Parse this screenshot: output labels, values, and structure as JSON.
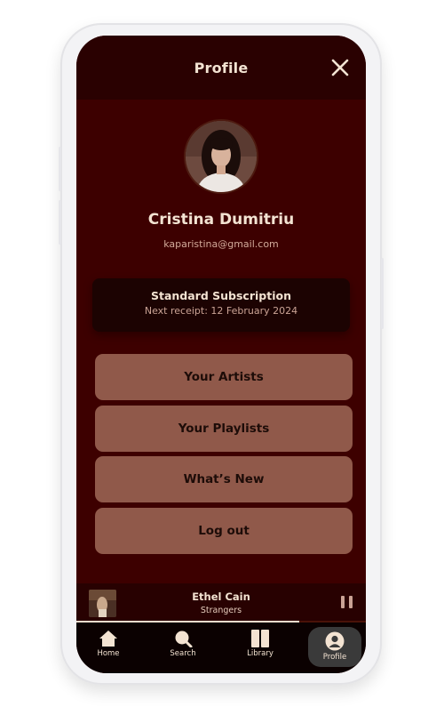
{
  "header": {
    "title": "Profile"
  },
  "profile": {
    "name": "Cristina Dumitriu",
    "email": "kaparistina@gmail.com"
  },
  "subscription": {
    "plan": "Standard Subscription",
    "next_receipt": "Next receipt: 12 February 2024"
  },
  "menu": [
    {
      "label": "Your Artists"
    },
    {
      "label": "Your Playlists"
    },
    {
      "label": "What’s New"
    },
    {
      "label": "Log out"
    }
  ],
  "now_playing": {
    "title": "Ethel Cain",
    "subtitle": "Strangers",
    "progress": 0.77,
    "control_icon": "pause-icon"
  },
  "nav": [
    {
      "label": "Home",
      "icon": "home-icon",
      "active": false
    },
    {
      "label": "Search",
      "icon": "search-icon",
      "active": false
    },
    {
      "label": "Library",
      "icon": "library-icon",
      "active": false
    },
    {
      "label": "Profile",
      "icon": "user-icon",
      "active": true
    }
  ],
  "colors": {
    "screen_bg": "#3d0000",
    "header_bg": "#2a0101",
    "button_bg": "#90594a",
    "card_bg": "#1c0302",
    "nav_bg": "#0b0101",
    "text_light": "#f3e3d2"
  }
}
